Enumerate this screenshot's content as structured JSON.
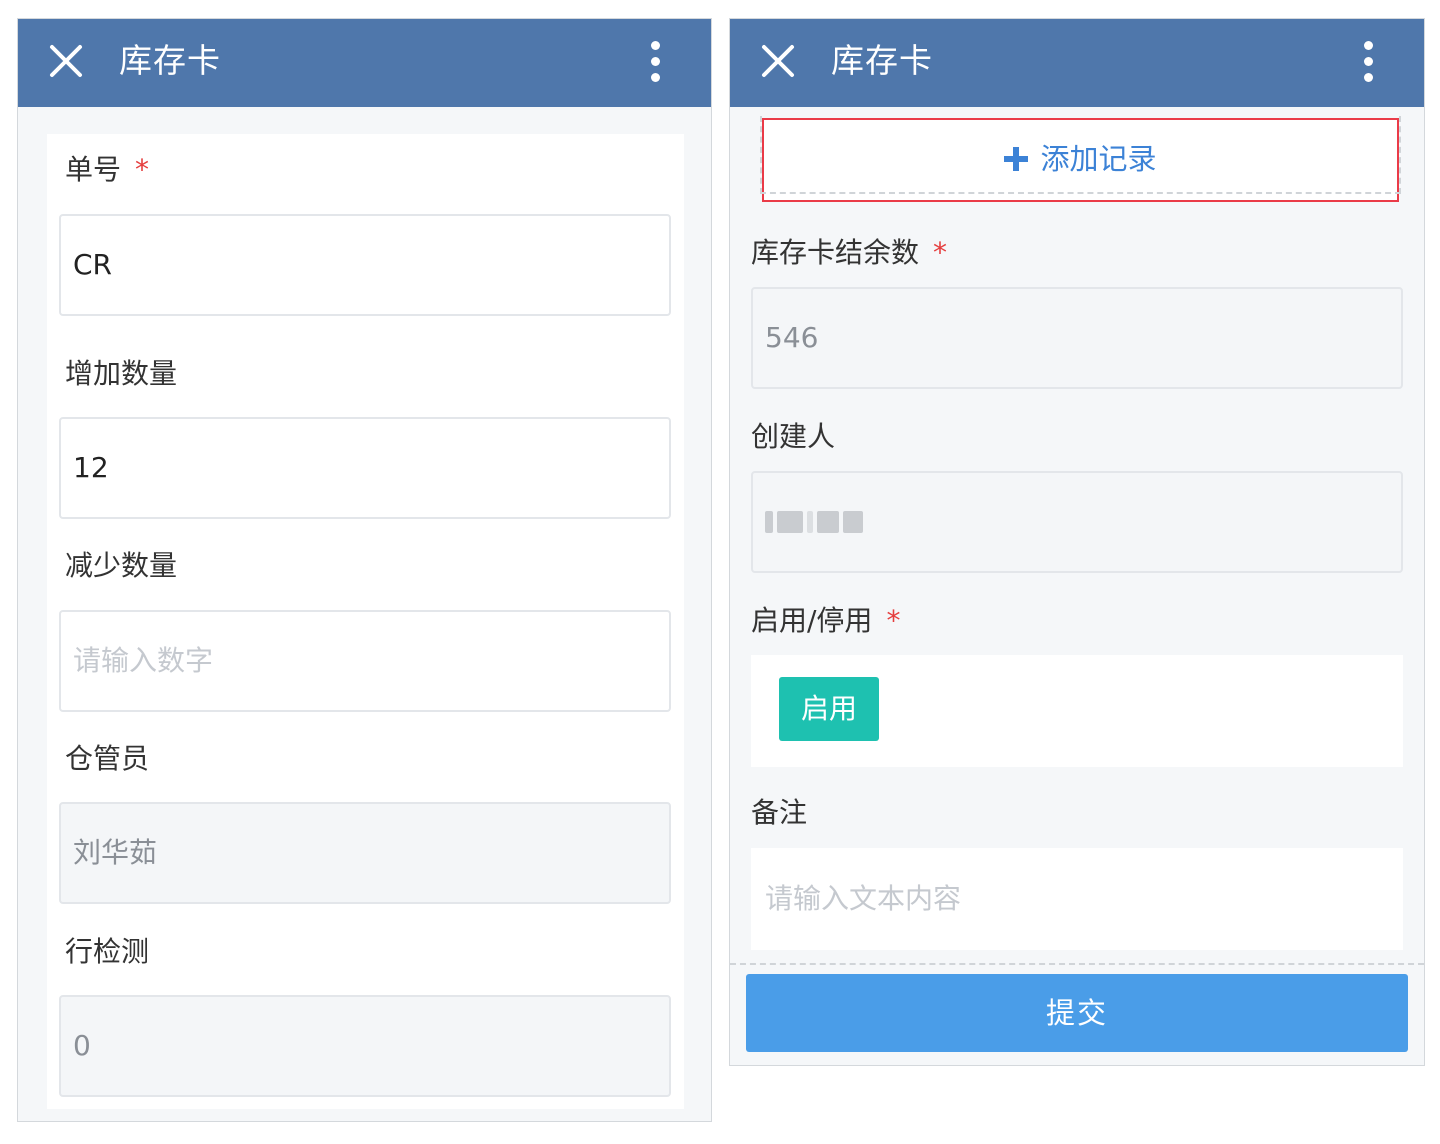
{
  "left_panel": {
    "header": {
      "title": "库存卡"
    },
    "fields": {
      "order_no": {
        "label": "单号",
        "required_mark": "*",
        "value": "CR"
      },
      "increase_qty": {
        "label": "增加数量",
        "value": "12"
      },
      "decrease_qty": {
        "label": "减少数量",
        "placeholder": "请输入数字"
      },
      "warehouse_keeper": {
        "label": "仓管员",
        "value": "刘华茹"
      },
      "row_check": {
        "label": "行检测",
        "value": "0"
      }
    }
  },
  "right_panel": {
    "header": {
      "title": "库存卡"
    },
    "add_record_label": "添加记录",
    "fields": {
      "balance": {
        "label": "库存卡结余数",
        "required_mark": "*",
        "value": "546"
      },
      "creator": {
        "label": "创建人"
      },
      "enable_toggle": {
        "label": "启用/停用",
        "required_mark": "*",
        "value": "启用"
      },
      "remarks": {
        "label": "备注",
        "placeholder": "请输入文本内容"
      }
    },
    "submit_label": "提交"
  },
  "colors": {
    "header": "#4f77ab",
    "required": "#e53e3e",
    "enable_button": "#1ec1b0",
    "submit_button": "#4a9de8",
    "add_record_text": "#3c82d6",
    "highlight_border": "#ea3b48"
  }
}
